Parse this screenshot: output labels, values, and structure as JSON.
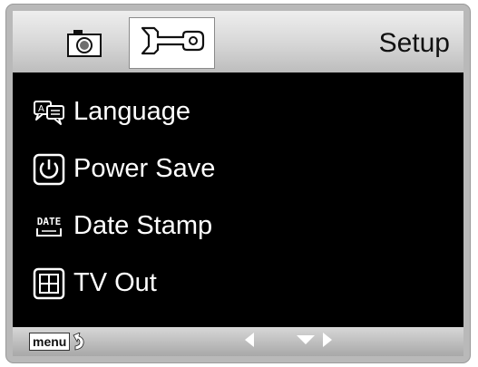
{
  "header": {
    "title": "Setup",
    "tabs": [
      {
        "icon": "camera-icon",
        "active": false
      },
      {
        "icon": "wrench-icon",
        "active": true
      }
    ]
  },
  "menu": {
    "items": [
      {
        "icon": "language-icon",
        "label": "Language"
      },
      {
        "icon": "power-icon",
        "label": "Power Save"
      },
      {
        "icon": "date-stamp-icon",
        "label": "Date Stamp",
        "icon_text": "DATE"
      },
      {
        "icon": "tv-out-icon",
        "label": "TV Out"
      }
    ]
  },
  "footer": {
    "menu_label": "menu",
    "icons": [
      "return-icon",
      "left-arrow-icon",
      "down-arrow-icon",
      "right-arrow-icon"
    ]
  }
}
